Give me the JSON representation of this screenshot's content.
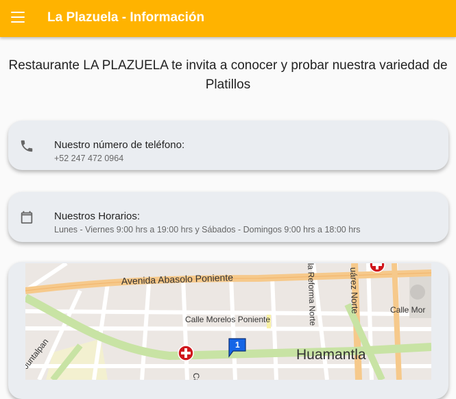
{
  "appbar": {
    "title": "La Plazuela - Información",
    "menu_icon": "menu-icon",
    "color": "#ffb300"
  },
  "intro": {
    "line1": "Restaurante LA PLAZUELA te invita a conocer y probar nuestra variedad de",
    "line2": "Platillos"
  },
  "phone_card": {
    "icon": "phone-icon",
    "title": "Nuestro número de teléfono:",
    "value": "+52 247 472 0964"
  },
  "hours_card": {
    "icon": "calendar-icon",
    "title": "Nuestros Horarios:",
    "value": "Lunes - Viernes 9:00 hrs a 19:00 hrs y Sábados - Domingos 9:00 hrs a 18:00 hrs"
  },
  "map": {
    "streets": {
      "abasolo": "Avenida Abasolo Poniente",
      "morelos_pte": "Calle Morelos Poniente",
      "reforma": "la Reforma Norte",
      "juarez": "uárez Norte",
      "morelos_ote": "Calle Mor",
      "juntalpan": "Juntalpan",
      "calle_partial": "Ca"
    },
    "city": "Huamantla",
    "marker_number": "1"
  }
}
